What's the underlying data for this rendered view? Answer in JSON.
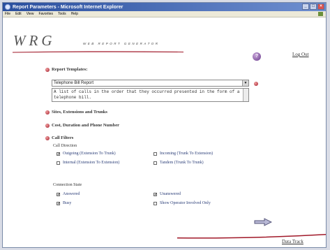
{
  "window": {
    "title": "Report Parameters - Microsoft Internet Explorer",
    "minimize_label": "_",
    "maximize_label": "□",
    "close_label": "×"
  },
  "menu": {
    "items": [
      "File",
      "Edit",
      "View",
      "Favorites",
      "Tools",
      "Help"
    ]
  },
  "header": {
    "logo": "WRG",
    "tagline": "WEB REPORT GENERATOR",
    "help_label": "?",
    "logout": "Log Out"
  },
  "templates": {
    "heading": "Report Templates:",
    "selected": "Telephone Bill Report",
    "description": "A list of calls in the order that they occurred presented in the form of a telephone bill."
  },
  "sections": {
    "sites": "Sites, Extensions and Trunks",
    "cost": "Cost, Duration and Phone Number",
    "filters": "Call Filters"
  },
  "filters": {
    "direction_label": "Call Direction",
    "outgoing": {
      "label": "Outgoing (Extension To Trunk)",
      "checked": true
    },
    "internal": {
      "label": "Internal (Extension To Extension)",
      "checked": false
    },
    "incoming": {
      "label": "Incoming (Trunk To Extension)",
      "checked": false
    },
    "tandem": {
      "label": "Tandem (Trunk To Trunk)",
      "checked": false
    },
    "state_label": "Connection State",
    "answered": {
      "label": "Answered",
      "checked": true
    },
    "busy": {
      "label": "Busy",
      "checked": true
    },
    "unanswered": {
      "label": "Unanswered",
      "checked": true
    },
    "operator": {
      "label": "Show Operator Involved Only",
      "checked": false
    }
  },
  "footer": {
    "link": "Data Track"
  },
  "colors": {
    "accent": "#a01828",
    "title_bar": "#2a4f9e",
    "checkbox_text": "#2b3e78"
  }
}
